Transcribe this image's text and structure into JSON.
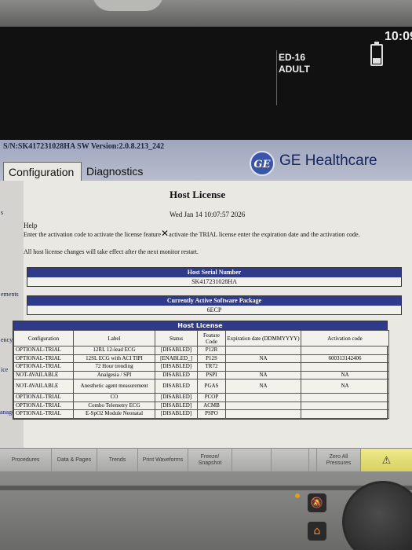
{
  "top_screen": {
    "time": "10:09",
    "bed": "ED-16",
    "patient_type": "ADULT"
  },
  "header": {
    "serial_line": "S/N:SK417231028HA  SW Version:2.0.8.213_242",
    "tabs": [
      {
        "label": "Configuration",
        "active": true
      },
      {
        "label": "Diagnostics",
        "active": false
      }
    ],
    "brand_logo": "GE",
    "brand": "GE Healthcare"
  },
  "left_gutter": [
    "s",
    "ements",
    "ency",
    "ice",
    "anagement"
  ],
  "page": {
    "title": "Host License",
    "date": "Wed Jan 14 10:07:57 2026",
    "help": "Help",
    "instructions_before": "Enter the activation code to activate the license feature",
    "instructions_after": "activate the TRIAL license enter the expiration date and the activation code.",
    "restart_note": "All host license changes will take effect after the next monitor restart."
  },
  "serial_box": {
    "heading": "Host Serial Number",
    "value": "SK417231028HA"
  },
  "package_box": {
    "heading": "Currently Active Software Package",
    "value": "6ECP"
  },
  "license_table": {
    "heading": "Host License",
    "columns": [
      "Configuration",
      "Label",
      "Status",
      "Feature Code",
      "Expiration date (DDMMYYYY)",
      "Activation code"
    ],
    "rows": [
      [
        "OPTIONAL-TRIAL",
        "12RL 12-lead ECG",
        "[DISABLED]",
        "P12R",
        "",
        ""
      ],
      [
        "OPTIONAL-TRIAL",
        "12SL ECG with ACI TIPI",
        "[ENABLED_]",
        "P12S",
        "NA",
        "600313142406"
      ],
      [
        "OPTIONAL-TRIAL",
        "72 Hour trending",
        "[DISABLED]",
        "TR72",
        "",
        ""
      ],
      [
        "NOT-AVAILABLE",
        "Analgesia / SPI",
        "DISABLED",
        "PSPI",
        "NA",
        "NA"
      ],
      [
        "NOT-AVAILABLE",
        "Anesthetic agent measurement",
        "DISABLED",
        "PGAS",
        "NA",
        "NA"
      ],
      [
        "OPTIONAL-TRIAL",
        "CO",
        "[DISABLED]",
        "PCOP",
        "",
        ""
      ],
      [
        "OPTIONAL-TRIAL",
        "Combo Telemetry ECG",
        "[DISABLED]",
        "ACMB",
        "",
        ""
      ],
      [
        "OPTIONAL-TRIAL",
        "E-SpO2 Module Neonatal",
        "[DISABLED]",
        "PSPO",
        "",
        ""
      ]
    ]
  },
  "softkeys": [
    {
      "label": "Procedures",
      "dim": false
    },
    {
      "label": "Data & Pages",
      "dim": false
    },
    {
      "label": "Trends",
      "dim": false
    },
    {
      "label": "Print Waveforms",
      "dim": false
    },
    {
      "label": "Freeze/ Snapshot",
      "dim": false
    },
    {
      "label": "",
      "dim": true
    },
    {
      "label": "",
      "dim": true
    },
    {
      "label": "",
      "dim": true
    },
    {
      "label": "Zero All Pressures",
      "dim": false
    }
  ],
  "colors": {
    "header_band": "#2f3a8a",
    "brand_blue": "#3a55a8",
    "alarm_key": "#e5de72"
  }
}
